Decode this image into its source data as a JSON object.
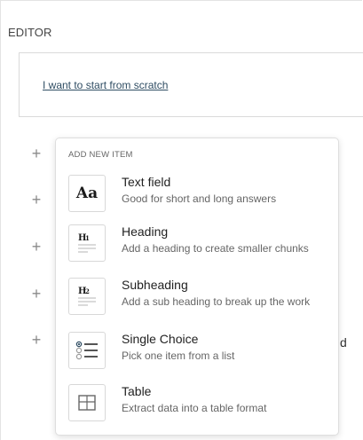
{
  "editor": {
    "title": "EDITOR",
    "scratch_link": "I want to start from scratch",
    "trailing_text": "d"
  },
  "add_menu": {
    "heading": "ADD NEW ITEM",
    "items": [
      {
        "icon": "text-field-icon",
        "glyph": "Aa",
        "title": "Text field",
        "description": "Good for short and long answers"
      },
      {
        "icon": "heading-icon",
        "glyph": "H1",
        "title": "Heading",
        "description": "Add a heading to create smaller chunks"
      },
      {
        "icon": "subheading-icon",
        "glyph": "H2",
        "title": "Subheading",
        "description": "Add a sub heading to break up the work"
      },
      {
        "icon": "single-choice-icon",
        "title": "Single Choice",
        "description": "Pick one item from a list"
      },
      {
        "icon": "table-icon",
        "title": "Table",
        "description": "Extract data into a table format"
      }
    ]
  },
  "add_buttons": [
    "+",
    "+",
    "+",
    "+",
    "+"
  ],
  "colors": {
    "link": "#2f4d63",
    "border": "#dadada",
    "muted_text": "#666666"
  }
}
